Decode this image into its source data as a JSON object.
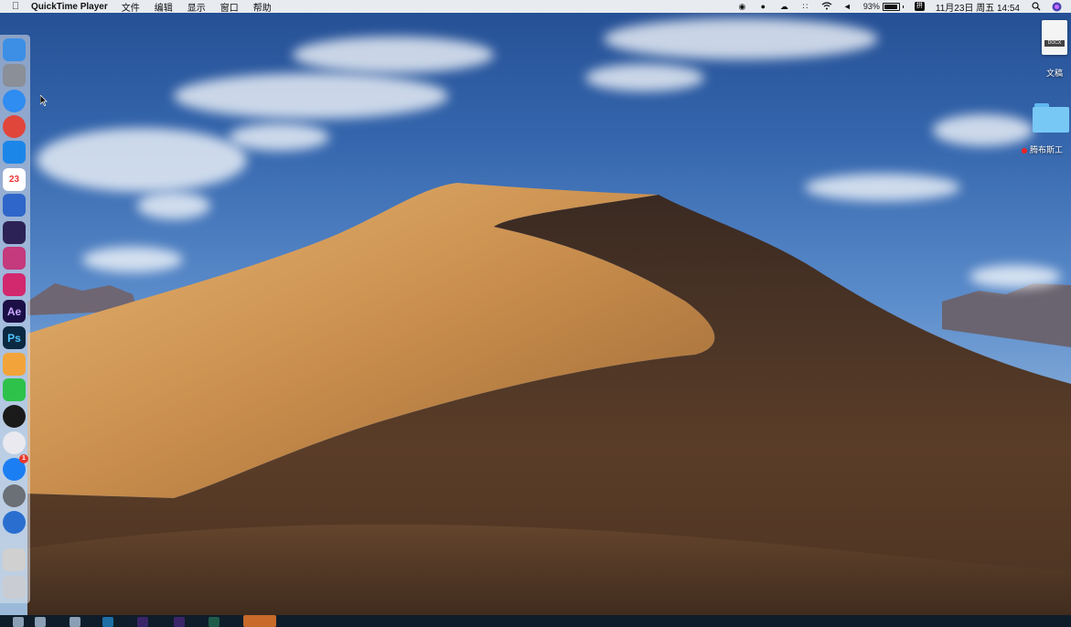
{
  "menubar": {
    "apple_icon": "apple-logo-icon",
    "app_name": "QuickTime Player",
    "menus": [
      "文件",
      "编辑",
      "显示",
      "窗口",
      "帮助"
    ],
    "status_icons": [
      "screen-record-icon",
      "qq-icon",
      "cloud-icon",
      "bluetooth-icon",
      "wifi-icon",
      "volume-icon"
    ],
    "battery_text": "93%",
    "battery_level": 0.93,
    "input_method_icon": "input-method-icon",
    "date_time": "11月23日 周五  14:54",
    "search_icon": "spotlight-search-icon",
    "siri_icon": "siri-icon"
  },
  "dock": {
    "items": [
      {
        "name": "finder",
        "icon": "finder-icon",
        "bg": "#3d8fe6"
      },
      {
        "name": "launchpad",
        "icon": "launchpad-rocket-icon",
        "bg": "#8a8f98"
      },
      {
        "name": "safari",
        "icon": "safari-compass-icon",
        "bg": "#2f8cf0"
      },
      {
        "name": "chrome",
        "icon": "chrome-icon",
        "bg": "#e0463a"
      },
      {
        "name": "mail",
        "icon": "mail-icon",
        "bg": "#1c86e8"
      },
      {
        "name": "calendar",
        "icon": "calendar-icon",
        "bg": "#ffffff",
        "label": "23"
      },
      {
        "name": "reminders",
        "icon": "task-check-icon",
        "bg": "#2f66c9"
      },
      {
        "name": "eclipse",
        "icon": "eclipse-icon",
        "bg": "#2c2255"
      },
      {
        "name": "final-cut",
        "icon": "clapper-icon",
        "bg": "#c43a7d"
      },
      {
        "name": "intellij",
        "icon": "intellij-icon",
        "bg": "#d2286e"
      },
      {
        "name": "after-effects",
        "icon": "after-effects-icon",
        "bg": "#1b0f45",
        "label": "Ae"
      },
      {
        "name": "photoshop",
        "icon": "photoshop-icon",
        "bg": "#0b2a42",
        "label": "Ps"
      },
      {
        "name": "butterfly",
        "icon": "butterfly-icon",
        "bg": "#f2a43a"
      },
      {
        "name": "wechat",
        "icon": "wechat-icon",
        "bg": "#2fc24b"
      },
      {
        "name": "qq",
        "icon": "qq-penguin-icon",
        "bg": "#1a1a1a"
      },
      {
        "name": "itunes",
        "icon": "music-note-icon",
        "bg": "#e9e9ef"
      },
      {
        "name": "app-store",
        "icon": "app-store-icon",
        "bg": "#1b7ef2",
        "badge": "1"
      },
      {
        "name": "system-preferences",
        "icon": "gear-icon",
        "bg": "#6b6f76"
      },
      {
        "name": "quicktime",
        "icon": "quicktime-icon",
        "bg": "#2a6fd0"
      },
      {
        "name": "screenshot",
        "icon": "printer-icon",
        "bg": "#d0d0d0"
      },
      {
        "name": "trash",
        "icon": "trash-icon",
        "bg": "#c9ccd2"
      }
    ]
  },
  "desktop": {
    "file_label": "文稿",
    "file_tag": "DOCX",
    "folder_label": "腾布斯工"
  },
  "colors": {
    "menubar_bg": "#e8ebf0",
    "taskbar_bg": "#0f1d2b",
    "dune_light": "#e9b877",
    "dune_dark": "#4a3323"
  },
  "taskbar": {
    "items": [
      "network-icon",
      "search-icon",
      "gear-icon",
      "photoshop-icon",
      "premiere-icon",
      "premiere-icon",
      "file-icon",
      "active-app-icon"
    ]
  }
}
